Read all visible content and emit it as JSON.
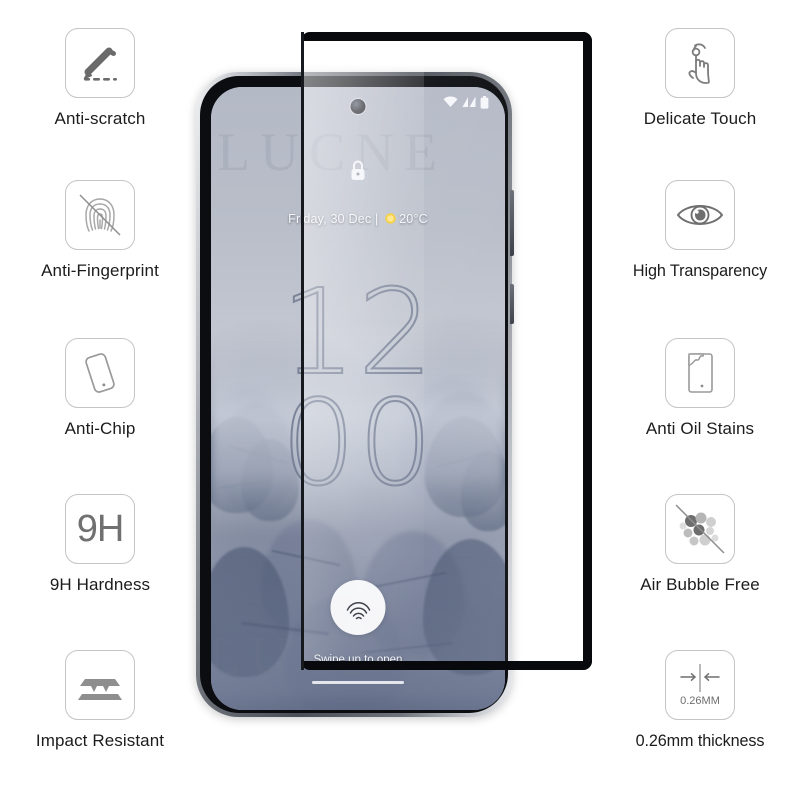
{
  "product": {
    "type": "tempered-glass-screen-protector",
    "thickness_value": "0.26MM"
  },
  "features_left": [
    {
      "label": "Anti-scratch",
      "icon": "pen-scratch-icon"
    },
    {
      "label": "Anti-Fingerprint",
      "icon": "fingerprint-crossed-icon"
    },
    {
      "label": "Anti-Chip",
      "icon": "phone-tilt-icon"
    },
    {
      "label": "9H Hardness",
      "icon": "hardness-9h-icon",
      "icon_text": "9H"
    },
    {
      "label": "Impact Resistant",
      "icon": "impact-layers-icon"
    }
  ],
  "features_right": [
    {
      "label": "Delicate Touch",
      "icon": "touch-hand-icon"
    },
    {
      "label": "High Transparency",
      "icon": "eye-icon"
    },
    {
      "label": "Anti Oil Stains",
      "icon": "phone-oil-drop-icon"
    },
    {
      "label": "Air Bubble Free",
      "icon": "bubbles-crossed-icon"
    },
    {
      "label": "0.26mm thickness",
      "icon": "thickness-arrows-icon",
      "icon_text": "0.26MM"
    }
  ],
  "phone_screen": {
    "status_bar": {
      "wifi_icon": "wifi-icon",
      "signal_icon": "cellular-signal-icon",
      "battery_icon": "battery-icon",
      "camera_icon": "punch-hole-camera-icon"
    },
    "lock_icon": "lock-closed-icon",
    "date_text": "Friday, 30 Dec",
    "date_separator": "|",
    "weather_icon": "sun-icon",
    "temperature": "20°C",
    "clock_hours": "12",
    "clock_minutes": "00",
    "fingerprint_icon": "fingerprint-sensor-icon",
    "swipe_hint": "Swipe up to open",
    "home_indicator": "home-indicator"
  },
  "watermark": {
    "text": "LUCNE"
  },
  "colors": {
    "background": "#ffffff",
    "icon_border": "#c4c4c4",
    "icon_glyph": "#6b6b6b",
    "label_text": "#1c1c1c",
    "glass_frame": "#07090c"
  }
}
